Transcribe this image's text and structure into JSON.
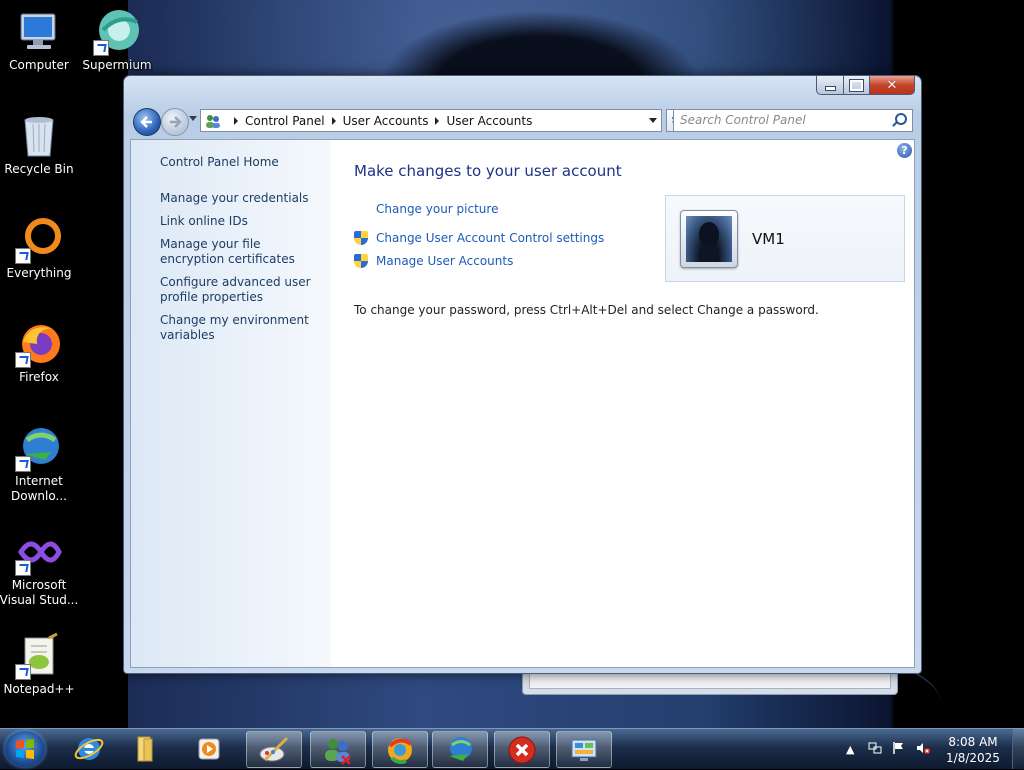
{
  "desktop": {
    "icons": [
      {
        "label": "Computer"
      },
      {
        "label": "Supermium"
      },
      {
        "label": "Recycle Bin"
      },
      {
        "label": "Everything"
      },
      {
        "label": "Firefox"
      },
      {
        "label": "Internet Downlo..."
      },
      {
        "label": "Microsoft Visual Stud..."
      },
      {
        "label": "Notepad++"
      }
    ]
  },
  "window": {
    "breadcrumb": [
      "Control Panel",
      "User Accounts",
      "User Accounts"
    ],
    "search_placeholder": "Search Control Panel",
    "sidebar": {
      "home": "Control Panel Home",
      "links": [
        "Manage your credentials",
        "Link online IDs",
        "Manage your file encryption certificates",
        "Configure advanced user profile properties",
        "Change my environment variables"
      ]
    },
    "main": {
      "title": "Make changes to your user account",
      "tasks": [
        {
          "label": "Change your picture",
          "icon": "none"
        },
        {
          "label": "Change User Account Control settings",
          "icon": "uac-shield-icon"
        },
        {
          "label": "Manage User Accounts",
          "icon": "uac-shield-icon"
        }
      ],
      "account_name": "VM1",
      "password_note": "To change your password, press Ctrl+Alt+Del and select Change a password."
    }
  },
  "taskbar": {
    "time": "8:08 AM",
    "date": "1/8/2025",
    "apps": [
      "internet-explorer-icon",
      "file-explorer-icon",
      "media-player-icon",
      "paint-icon",
      "user-manager-icon",
      "supermium-icon",
      "download-manager-icon",
      "error-icon",
      "control-panel-icon"
    ]
  }
}
